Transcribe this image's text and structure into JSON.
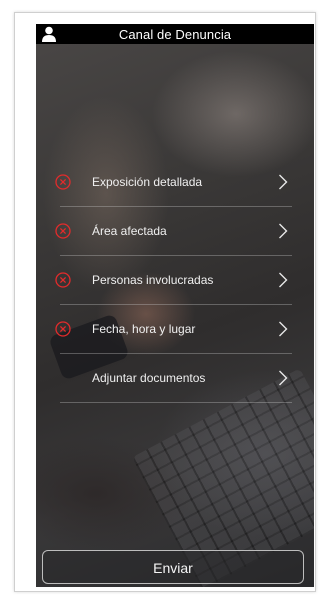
{
  "header": {
    "title": "Canal de Denuncia",
    "user_icon": "user-icon"
  },
  "menu": {
    "items": [
      {
        "label": "Exposición detallada",
        "status": "incomplete",
        "status_color": "#e32b2b"
      },
      {
        "label": "Área afectada",
        "status": "incomplete",
        "status_color": "#e32b2b"
      },
      {
        "label": "Personas involucradas",
        "status": "incomplete",
        "status_color": "#e32b2b"
      },
      {
        "label": "Fecha, hora y lugar",
        "status": "incomplete",
        "status_color": "#e32b2b"
      },
      {
        "label": "Adjuntar documentos",
        "status": "none"
      }
    ]
  },
  "footer": {
    "send_label": "Enviar"
  },
  "colors": {
    "topbar": "#000000",
    "error": "#e32b2b",
    "text": "#f0f0f0"
  }
}
